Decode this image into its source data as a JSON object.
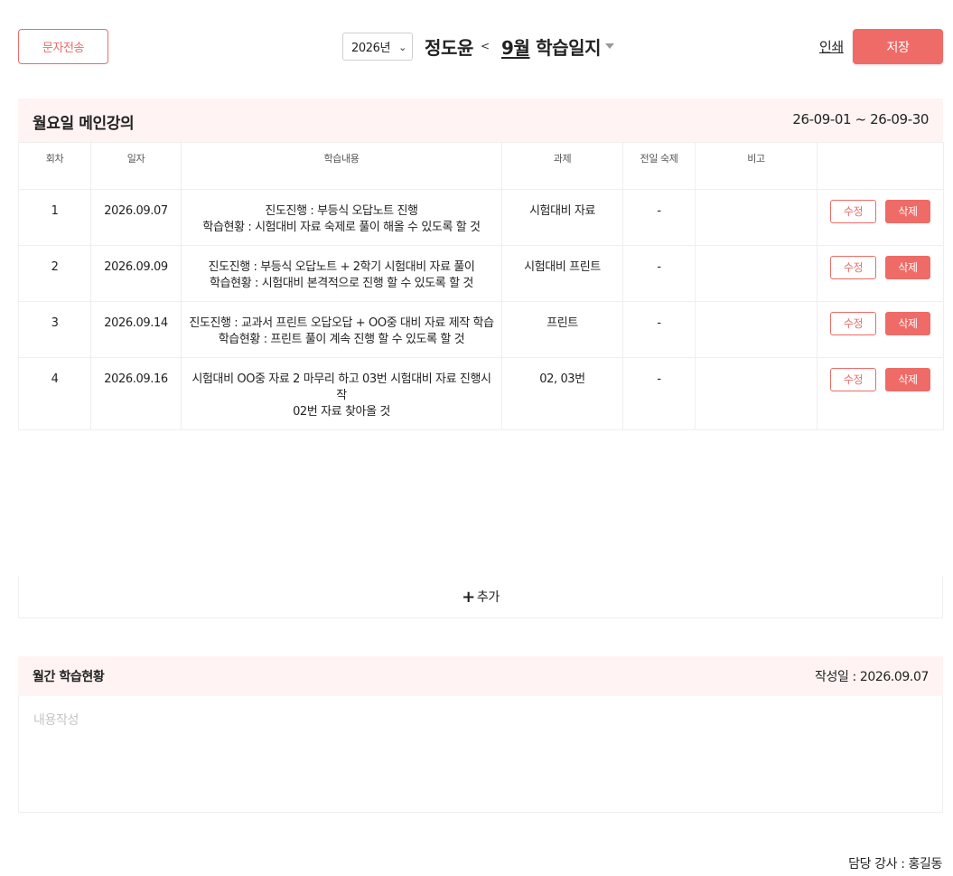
{
  "header": {
    "sms_button": "문자전송",
    "year": "2026년",
    "student_name": "정도윤",
    "month": "9월",
    "journal_title": "학습일지",
    "print_label": "인쇄",
    "save_label": "저장"
  },
  "lecture": {
    "title": "월요일 메인강의",
    "date_range": "26-09-01 ~ 26-09-30",
    "columns": [
      "회차",
      "일자",
      "학습내용",
      "과제",
      "전일 숙제",
      "비고",
      ""
    ],
    "rows": [
      {
        "no": "1",
        "date": "2026.09.07",
        "content": [
          "진도진행 : 부등식 오답노트 진행",
          "학습현황 : 시험대비 자료 숙제로 풀이 해올 수 있도록 할 것"
        ],
        "homework": "시험대비 자료",
        "prev": "-",
        "note": ""
      },
      {
        "no": "2",
        "date": "2026.09.09",
        "content": [
          "진도진행 : 부등식 오답노트 + 2학기 시험대비 자료 풀이",
          "학습현황 : 시험대비 본격적으로 진행 할 수 있도록 할 것"
        ],
        "homework": "시험대비 프린트",
        "prev": "-",
        "note": ""
      },
      {
        "no": "3",
        "date": "2026.09.14",
        "content": [
          "진도진행 : 교과서 프린트 오답오답 + OO중  대비 자료 제작 학습",
          "학습현황 : 프린트 풀이 계속 진행 할 수 있도록 할 것"
        ],
        "homework": "프린트",
        "prev": "-",
        "note": ""
      },
      {
        "no": "4",
        "date": "2026.09.16",
        "content": [
          "시험대비 OO중 자료 2 마무리 하고 03번 시험대비 자료 진행시작",
          "02번 자료 찾아올 것"
        ],
        "homework": "02, 03번",
        "prev": "-",
        "note": ""
      }
    ],
    "edit_label": "수정",
    "delete_label": "삭제",
    "add_label": "추가"
  },
  "monthly": {
    "title": "월간 학습현황",
    "written_date": "작성일 : 2026.09.07",
    "placeholder": "내용작성"
  },
  "teacher": "담당 강사 : 홍길동",
  "colors": {
    "accent": "#ee6b67",
    "header_bg": "#fff4f3",
    "border": "#efefef"
  }
}
